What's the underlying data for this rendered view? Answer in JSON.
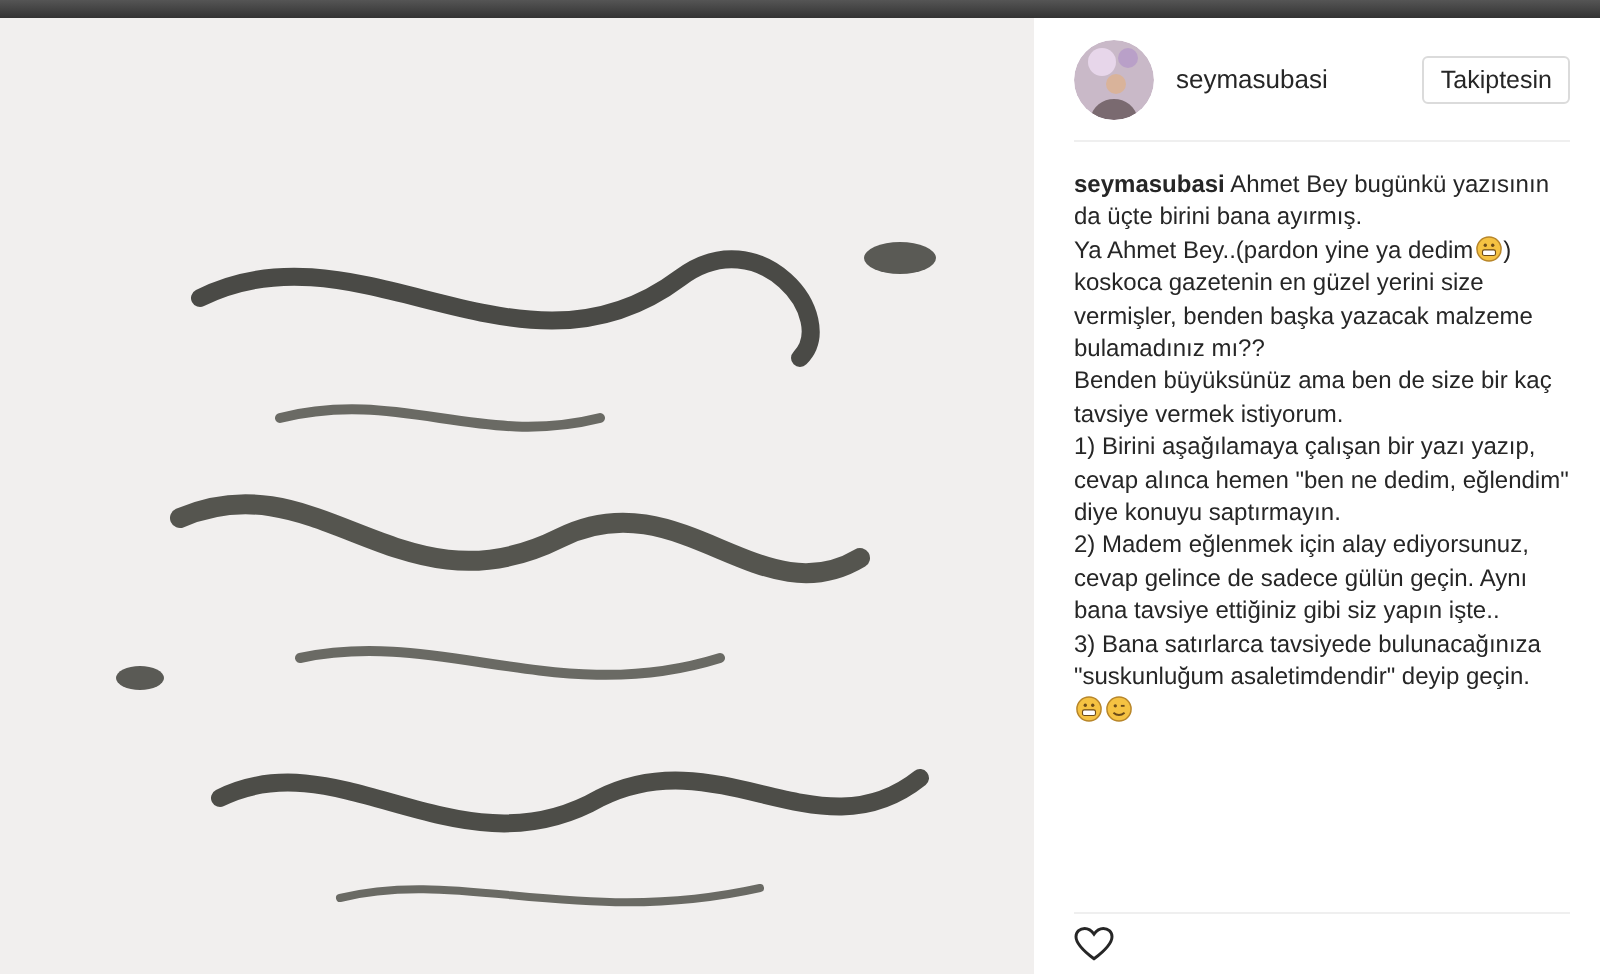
{
  "header": {
    "username": "seymasubasi",
    "follow_button": "Takiptesin"
  },
  "caption": [
    {
      "parts": [
        {
          "kind": "text",
          "text": "**seymasubasi** Ahmet Bey bugünkü yazısının da üçte birini bana ayırmış."
        }
      ]
    },
    {
      "parts": [
        {
          "kind": "text",
          "text": "Ya Ahmet Bey..(pardon yine ya dedim"
        },
        {
          "kind": "grimace"
        },
        {
          "kind": "text",
          "text": ")"
        }
      ]
    },
    {
      "parts": [
        {
          "kind": "text",
          "text": "koskoca gazetenin en güzel yerini size vermişler, benden başka yazacak malzeme bulamadınız mı??"
        }
      ]
    },
    {
      "parts": [
        {
          "kind": "text",
          "text": "Benden büyüksünüz ama ben de size bir kaç tavsiye vermek istiyorum."
        }
      ]
    },
    {
      "parts": [
        {
          "kind": "text",
          "text": "1) Birini aşağılamaya çalışan bir yazı yazıp, cevap alınca hemen \"ben ne dedim, eğlendim\" diye konuyu saptırmayın."
        }
      ]
    },
    {
      "parts": [
        {
          "kind": "text",
          "text": "2) Madem eğlenmek için alay ediyorsunuz, cevap gelince de sadece gülün geçin. Aynı bana tavsiye ettiğiniz gibi siz yapın işte.."
        }
      ]
    },
    {
      "parts": [
        {
          "kind": "text",
          "text": "3) Bana satırlarca tavsiyede bulunacağınıza \"suskunluğum asaletimdendir\" deyip geçin."
        }
      ]
    },
    {
      "parts": [
        {
          "kind": "grimace"
        },
        {
          "kind": "smile"
        }
      ]
    }
  ],
  "actions": {
    "liked": false
  }
}
